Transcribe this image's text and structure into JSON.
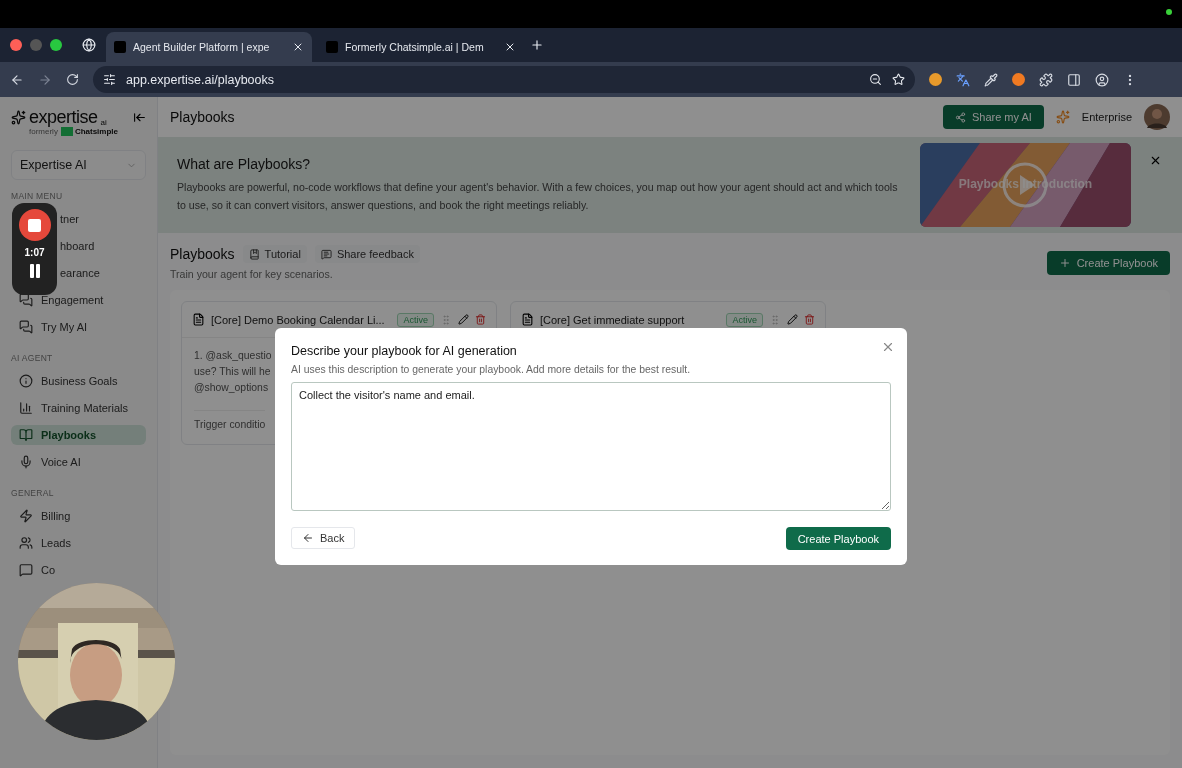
{
  "browser": {
    "tabs": [
      {
        "title": "Agent Builder Platform | expe",
        "selected": true
      },
      {
        "title": "Formerly Chatsimple.ai | Dem",
        "selected": false
      }
    ],
    "url": "app.expertise.ai/playbooks"
  },
  "recorder": {
    "time": "1:07"
  },
  "sidebar": {
    "logo": "expertise",
    "logo_suffix": "ai",
    "formerly": "formerly",
    "partner": "Chatsimple",
    "workspace": "Expertise AI",
    "sections": [
      {
        "title": "MAIN MENU",
        "items": [
          {
            "label": "tner",
            "selected": false
          },
          {
            "label": "hboard",
            "selected": false
          },
          {
            "label": "earance",
            "selected": false
          },
          {
            "label": "Engagement",
            "selected": false
          },
          {
            "label": "Try My AI",
            "selected": false
          }
        ]
      },
      {
        "title": "AI AGENT",
        "items": [
          {
            "label": "Business Goals",
            "selected": false
          },
          {
            "label": "Training Materials",
            "selected": false
          },
          {
            "label": "Playbooks",
            "selected": true
          },
          {
            "label": "Voice AI",
            "selected": false
          }
        ]
      },
      {
        "title": "GENERAL",
        "items": [
          {
            "label": "Billing",
            "selected": false
          },
          {
            "label": "Leads",
            "selected": false
          },
          {
            "label": "Co",
            "selected": false
          }
        ]
      }
    ]
  },
  "header": {
    "title": "Playbooks",
    "share_button": "Share my AI",
    "plan": "Enterprise"
  },
  "banner": {
    "title": "What are Playbooks?",
    "text": "Playbooks are powerful, no-code workflows that define your agent's behavior. With a few choices, you map out how your agent should act and which tools to use, so it can convert visitors, answer questions, and book the right meetings reliably.",
    "video_title": "Playbooks Introduction"
  },
  "playbooks": {
    "title": "Playbooks",
    "tutorial": "Tutorial",
    "feedback": "Share feedback",
    "subtitle": "Train your agent for key scenarios.",
    "create_button": "Create Playbook",
    "cards": [
      {
        "title": "[Core] Demo Booking Calendar Li...",
        "status": "Active",
        "lines": [
          "1. @ask_questio",
          "use? This will he",
          "@show_options"
        ],
        "trigger": "Trigger conditio"
      },
      {
        "title": "[Core] Get immediate support",
        "status": "Active"
      }
    ]
  },
  "modal": {
    "title": "Describe your playbook for AI generation",
    "subtitle": "AI uses this description to generate your playbook. Add more details for the best result.",
    "value": "Collect the visitor's name and email.",
    "back": "Back",
    "create": "Create Playbook"
  }
}
